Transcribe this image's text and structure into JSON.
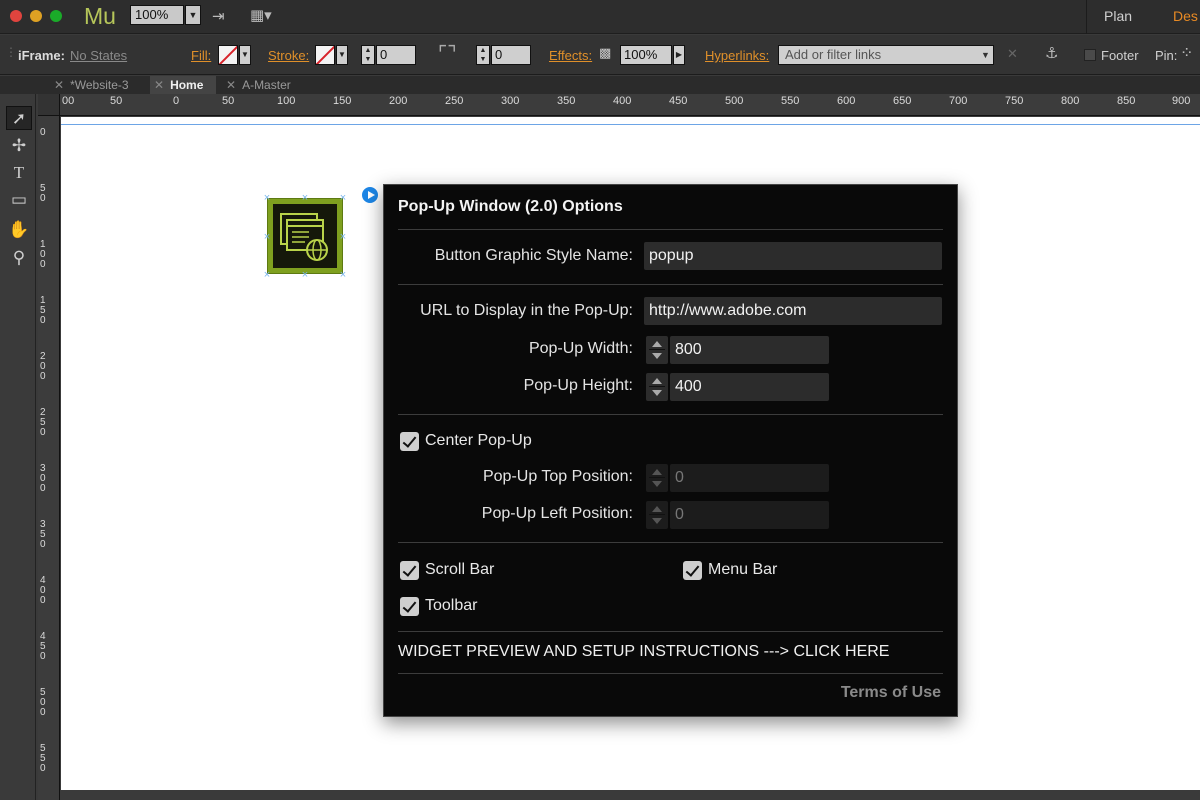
{
  "app": {
    "logo": "Mu",
    "zoom": "100%",
    "modes": {
      "plan": "Plan",
      "design": "Des"
    },
    "colors": {
      "accent_orange": "#e0902a",
      "widget_green": "#7fa01f",
      "selection_blue": "#1d86e6"
    }
  },
  "control_bar": {
    "iframe_label": "iFrame:",
    "iframe_state": "No States",
    "fill_label": "Fill:",
    "stroke_label": "Stroke:",
    "stroke_width": "0",
    "corner_radius": "0",
    "effects_label": "Effects:",
    "opacity": "100%",
    "hyperlinks_label": "Hyperlinks:",
    "hyperlinks_placeholder": "Add or filter links",
    "footer_label": "Footer",
    "pin_label": "Pin:"
  },
  "tabs": [
    {
      "label": "*Website-3"
    },
    {
      "label": "Home"
    },
    {
      "label": "A-Master"
    }
  ],
  "rulers": {
    "horizontal": [
      "00",
      "50",
      "0",
      "50",
      "100",
      "150",
      "200",
      "250",
      "300",
      "350",
      "400",
      "450",
      "500",
      "550",
      "600",
      "650",
      "700",
      "750",
      "800",
      "850",
      "900"
    ],
    "vertical": [
      "0",
      "50",
      "100",
      "150",
      "200",
      "250",
      "300",
      "350",
      "400",
      "450",
      "500",
      "550"
    ]
  },
  "panel": {
    "title": "Pop-Up Window (2.0) Options",
    "style_name_label": "Button Graphic Style Name:",
    "style_name_value": "popup",
    "url_label": "URL to Display in the Pop-Up:",
    "url_value": "http://www.adobe.com",
    "width_label": "Pop-Up Width:",
    "width_value": "800",
    "height_label": "Pop-Up Height:",
    "height_value": "400",
    "center_label": "Center Pop-Up",
    "top_label": "Pop-Up Top Position:",
    "top_value": "0",
    "left_label": "Pop-Up Left Position:",
    "left_value": "0",
    "scrollbar_label": "Scroll Bar",
    "menubar_label": "Menu Bar",
    "toolbar_label": "Toolbar",
    "instructions_link": "WIDGET PREVIEW AND SETUP INSTRUCTIONS ---> CLICK HERE",
    "terms_link": "Terms of Use"
  }
}
